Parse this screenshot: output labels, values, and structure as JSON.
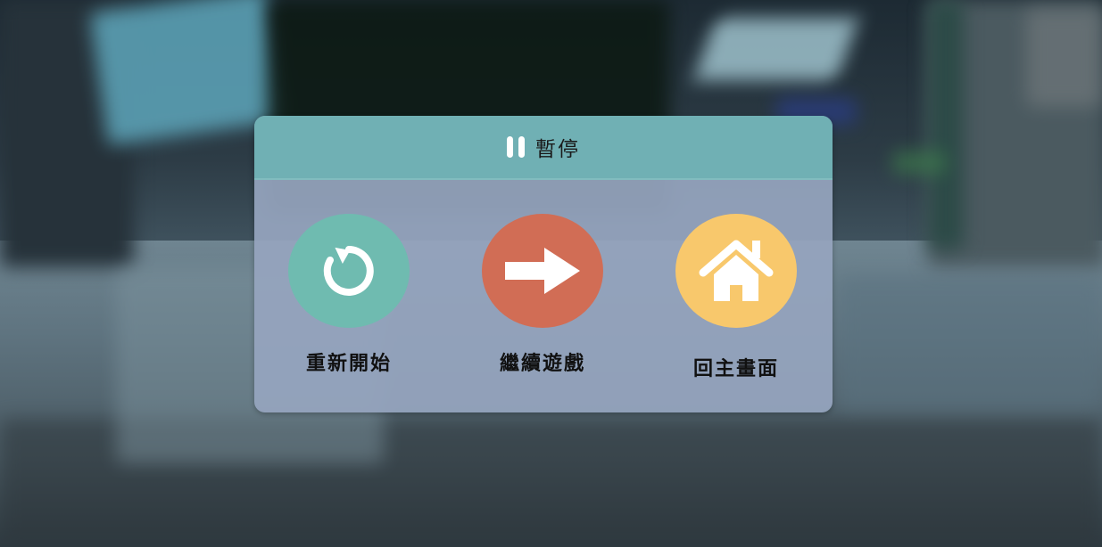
{
  "dialog": {
    "title": "暫停",
    "icon": "pause-icon"
  },
  "buttons": [
    {
      "label": "重新開始",
      "icon": "restart-icon",
      "color": "#6fbbb0"
    },
    {
      "label": "繼續遊戲",
      "icon": "arrow-right-icon",
      "color": "#d16d55"
    },
    {
      "label": "回主畫面",
      "icon": "home-icon",
      "color": "#f8c86c"
    }
  ],
  "colors": {
    "header": "#70b0b4",
    "panel": "#96a5be",
    "icon_fg": "#ffffff"
  }
}
